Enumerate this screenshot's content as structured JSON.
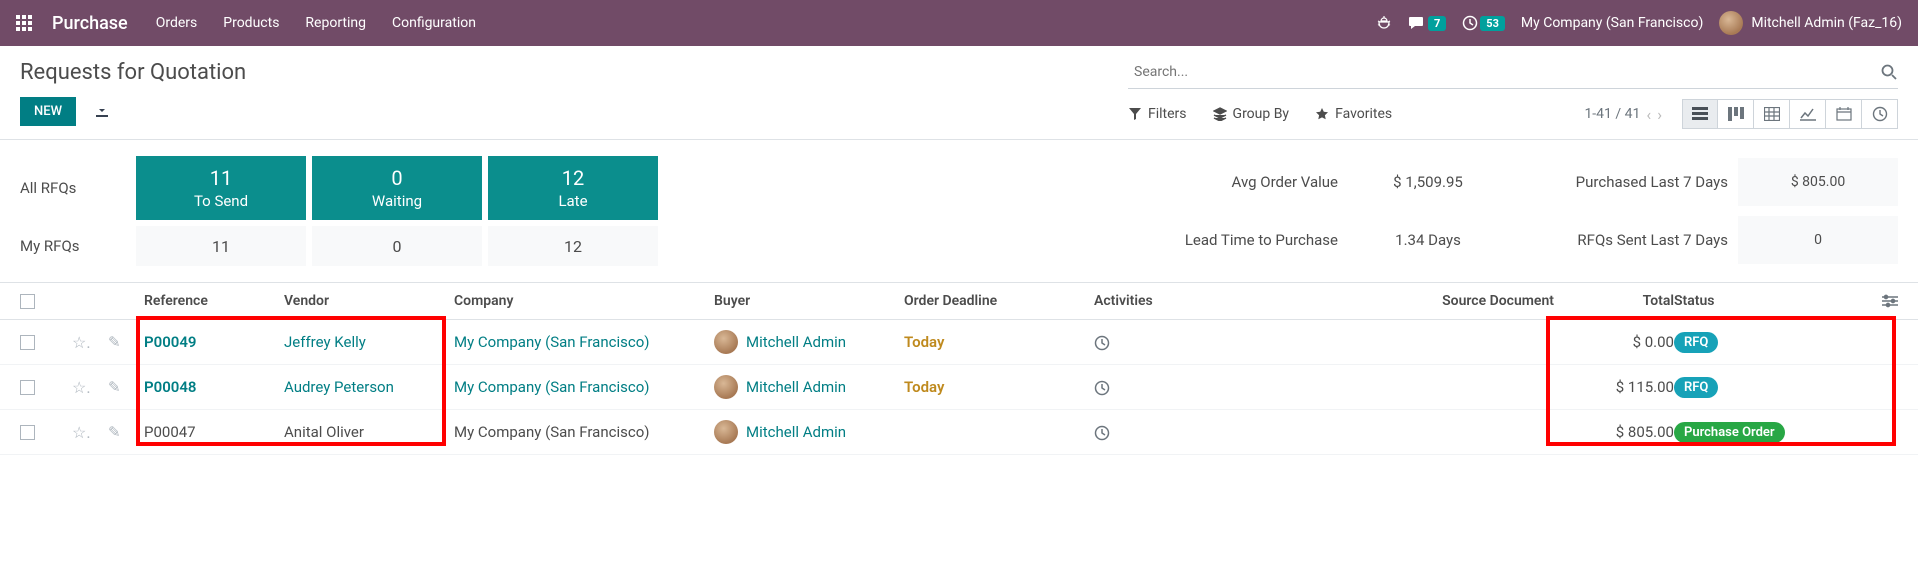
{
  "header": {
    "brand": "Purchase",
    "nav": [
      "Orders",
      "Products",
      "Reporting",
      "Configuration"
    ],
    "msg_count": "7",
    "clock_count": "53",
    "company": "My Company (San Francisco)",
    "user": "Mitchell Admin (Faz_16)"
  },
  "control": {
    "title": "Requests for Quotation",
    "new_btn": "NEW",
    "search_placeholder": "Search...",
    "filters": "Filters",
    "groupby": "Group By",
    "favorites": "Favorites",
    "pager": "1-41 / 41"
  },
  "dashboard": {
    "row1_label": "All RFQs",
    "row2_label": "My RFQs",
    "tosend": {
      "num": "11",
      "lbl": "To Send"
    },
    "waiting": {
      "num": "0",
      "lbl": "Waiting"
    },
    "late": {
      "num": "12",
      "lbl": "Late"
    },
    "my": [
      "11",
      "0",
      "12"
    ],
    "avg_lbl": "Avg Order Value",
    "avg_val": "$ 1,509.95",
    "p7_lbl": "Purchased Last 7 Days",
    "p7_val": "$ 805.00",
    "lead_lbl": "Lead Time to Purchase",
    "lead_val": "1.34 Days",
    "s7_lbl": "RFQs Sent Last 7 Days",
    "s7_val": "0"
  },
  "table": {
    "headers": {
      "reference": "Reference",
      "vendor": "Vendor",
      "company": "Company",
      "buyer": "Buyer",
      "deadline": "Order Deadline",
      "activities": "Activities",
      "source": "Source Document",
      "total": "Total",
      "status": "Status"
    },
    "rows": [
      {
        "ref": "P00049",
        "vendor": "Jeffrey Kelly",
        "company": "My Company (San Francisco)",
        "buyer": "Mitchell Admin",
        "deadline": "Today",
        "total": "$ 0.00",
        "status": "RFQ",
        "status_kind": "teal",
        "strong": true,
        "link_company": true
      },
      {
        "ref": "P00048",
        "vendor": "Audrey Peterson",
        "company": "My Company (San Francisco)",
        "buyer": "Mitchell Admin",
        "deadline": "Today",
        "total": "$ 115.00",
        "status": "RFQ",
        "status_kind": "teal",
        "strong": true,
        "link_company": true
      },
      {
        "ref": "P00047",
        "vendor": "Anital Oliver",
        "company": "My Company (San Francisco)",
        "buyer": "Mitchell Admin",
        "deadline": "",
        "total": "$ 805.00",
        "status": "Purchase Order",
        "status_kind": "green",
        "strong": false,
        "link_company": false
      }
    ]
  }
}
